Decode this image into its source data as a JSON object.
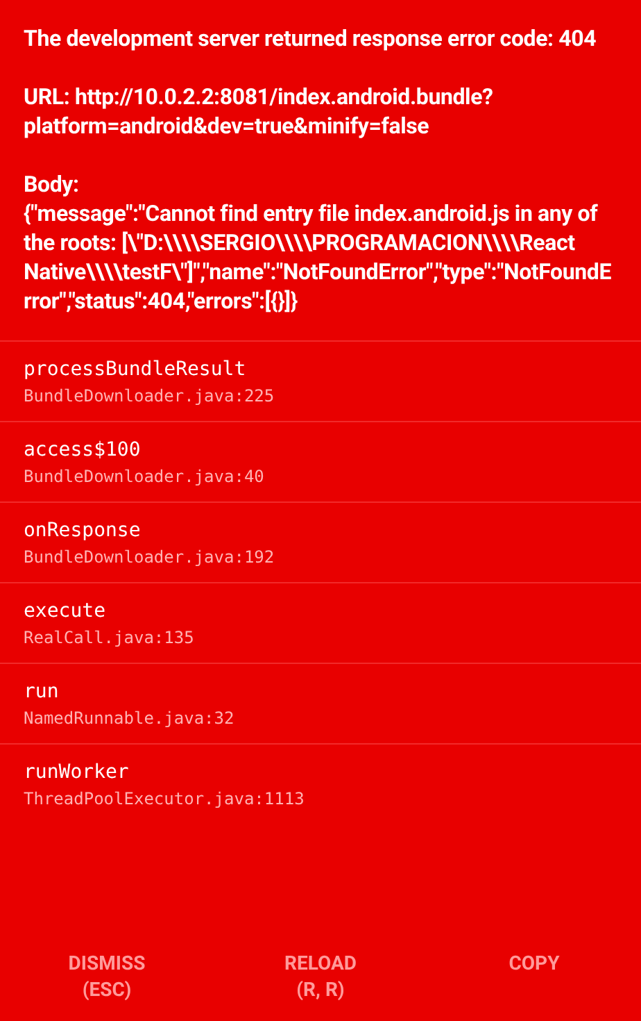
{
  "error": {
    "title": "The development server returned response error code: 404",
    "url": "URL: http://10.0.2.2:8081/index.android.bundle?platform=android&dev=true&minify=false",
    "body_label": "Body:",
    "body": "{\"message\":\"Cannot find entry file index.android.js in any of the roots: [\\\"D:\\\\\\\\SERGIO\\\\\\\\PROGRAMACION\\\\\\\\React Native\\\\\\\\testF\\\"]\",\"name\":\"NotFoundError\",\"type\":\"NotFoundError\",\"status\":404,\"errors\":[{}]}"
  },
  "stack": [
    {
      "method": "processBundleResult",
      "file": "BundleDownloader.java:225"
    },
    {
      "method": "access$100",
      "file": "BundleDownloader.java:40"
    },
    {
      "method": "onResponse",
      "file": "BundleDownloader.java:192"
    },
    {
      "method": "execute",
      "file": "RealCall.java:135"
    },
    {
      "method": "run",
      "file": "NamedRunnable.java:32"
    },
    {
      "method": "runWorker",
      "file": "ThreadPoolExecutor.java:1113"
    }
  ],
  "buttons": [
    {
      "label": "DISMISS",
      "shortcut": "(ESC)"
    },
    {
      "label": "RELOAD",
      "shortcut": "(R, R)"
    },
    {
      "label": "COPY"
    }
  ]
}
